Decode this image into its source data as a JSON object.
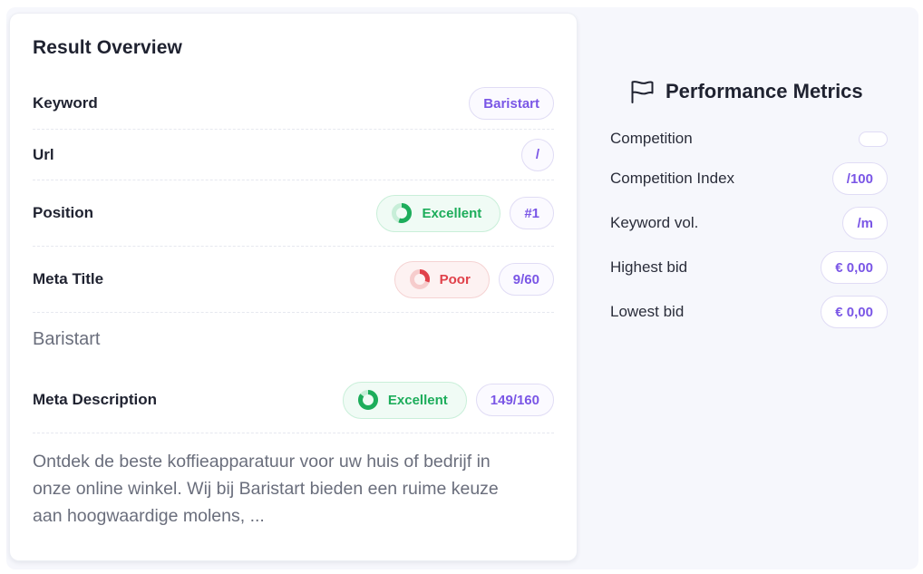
{
  "overview": {
    "title": "Result Overview",
    "keyword": {
      "label": "Keyword",
      "value": "Baristart"
    },
    "url": {
      "label": "Url",
      "value": "/"
    },
    "position": {
      "label": "Position",
      "status": "Excellent",
      "value": "#1"
    },
    "meta_title": {
      "label": "Meta Title",
      "status": "Poor",
      "count": "9/60",
      "text": "Baristart"
    },
    "meta_description": {
      "label": "Meta Description",
      "status": "Excellent",
      "count": "149/160",
      "text_lines": [
        "Ontdek de beste koffieapparatuur voor uw huis of bedrijf in",
        "onze online winkel. Wij bij Baristart bieden een ruime keuze",
        "aan hoogwaardige molens, ..."
      ]
    }
  },
  "metrics": {
    "title": "Performance Metrics",
    "icon": "flag-icon",
    "items": [
      {
        "label": "Competition",
        "value": ""
      },
      {
        "label": "Competition Index",
        "value": "/100"
      },
      {
        "label": "Keyword vol.",
        "value": "/m"
      },
      {
        "label": "Highest bid",
        "value": "€ 0,00"
      },
      {
        "label": "Lowest bid",
        "value": "€ 0,00"
      }
    ]
  },
  "colors": {
    "accent": "#7a56e6",
    "good": "#1dad5b",
    "bad": "#e0414a",
    "panel_bg": "#f6f7fc"
  },
  "score_rings": {
    "position": 0.55,
    "meta_title": 0.3,
    "meta_description": 0.85
  }
}
